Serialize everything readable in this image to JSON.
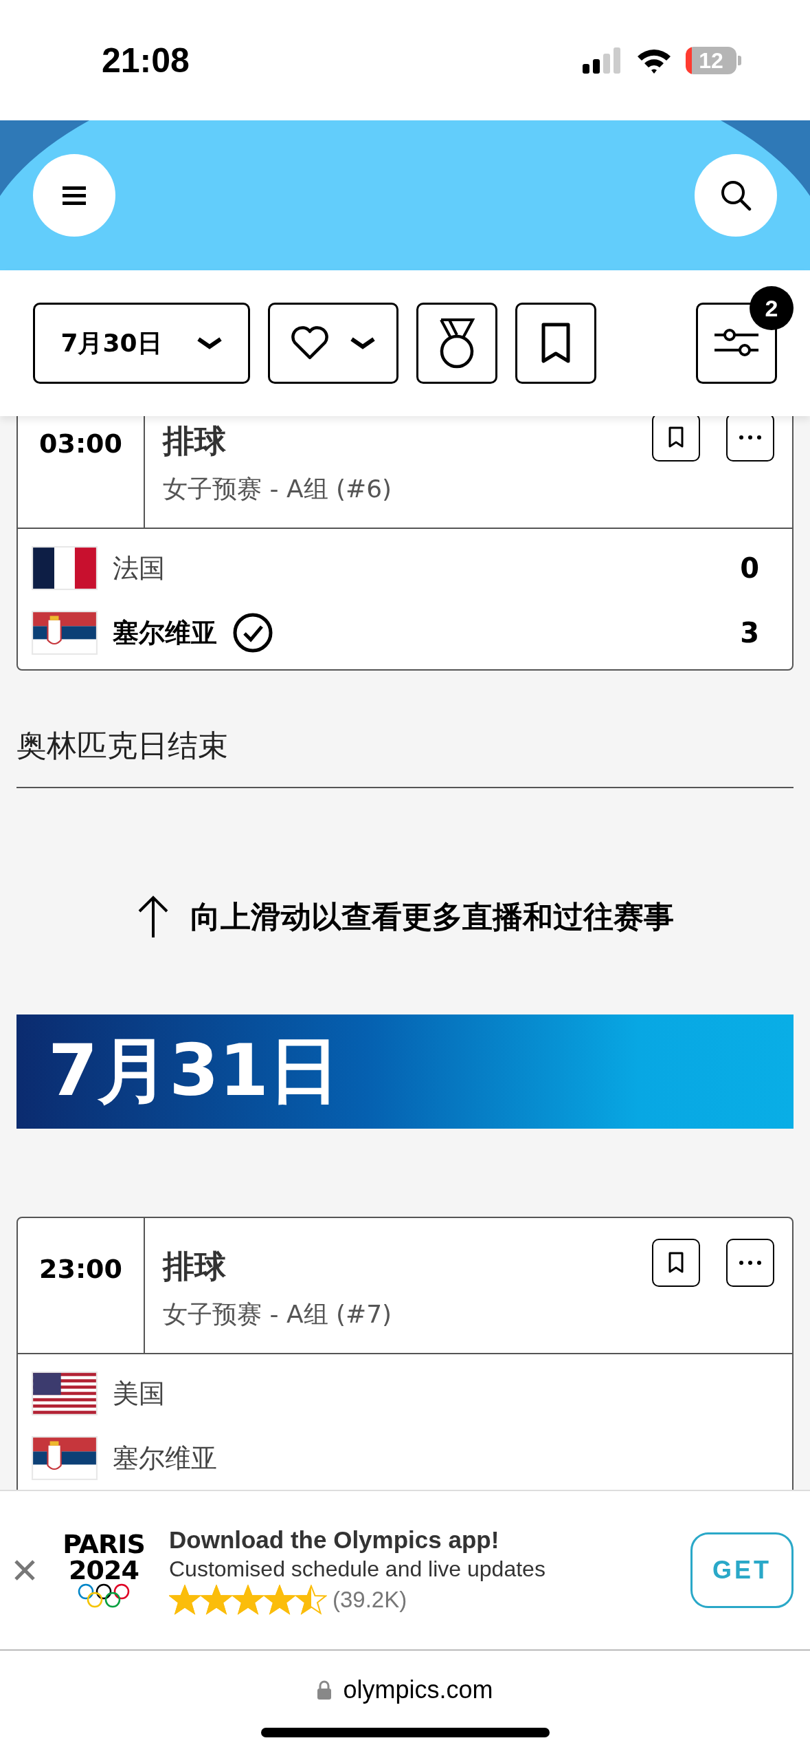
{
  "status_bar": {
    "time": "21:08",
    "battery": "12"
  },
  "filter_bar": {
    "date": "7月30日",
    "filter_badge": "2"
  },
  "content": [
    {
      "kind": "match",
      "time": "03:00",
      "sport": "排球",
      "event": "女子预赛 - A组 (#6)",
      "teams": [
        {
          "name": "法国",
          "kind": "france",
          "score": "0",
          "winner": false
        },
        {
          "name": "塞尔维亚",
          "kind": "serbia",
          "score": "3",
          "winner": true
        }
      ]
    },
    {
      "kind": "day_end",
      "text": "奥林匹克日结束"
    },
    {
      "kind": "scroll_hint",
      "text": "向上滑动以查看更多直播和过往赛事"
    },
    {
      "kind": "date_banner",
      "text": "7月31日"
    },
    {
      "kind": "match",
      "time": "23:00",
      "sport": "排球",
      "event": "女子预赛 - A组 (#7)",
      "teams": [
        {
          "name": "美国",
          "kind": "usa",
          "winner": false
        },
        {
          "name": "塞尔维亚",
          "kind": "serbia",
          "winner": false
        }
      ]
    }
  ],
  "app_banner": {
    "logo_lines": [
      "PARIS",
      "2024"
    ],
    "title": "Download the Olympics app!",
    "subtitle": "Customised schedule and live updates",
    "stars": 4.5,
    "rating_count": "(39.2K)",
    "button": "GET"
  },
  "url_bar": {
    "url": "olympics.com"
  }
}
